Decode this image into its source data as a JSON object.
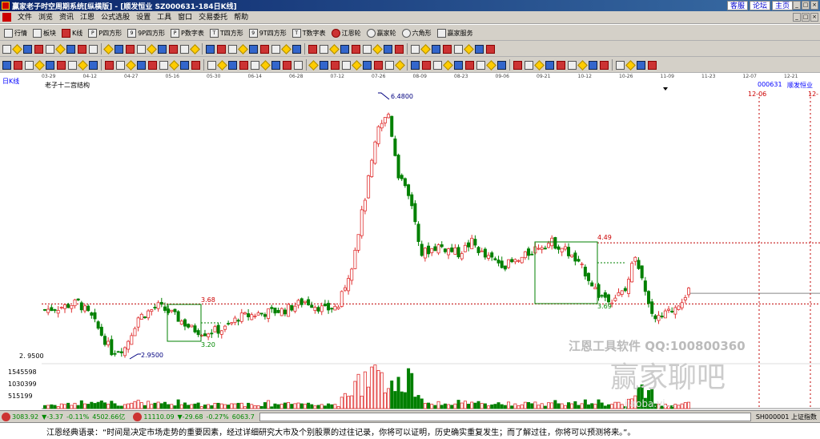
{
  "window": {
    "title": "赢家老子时空周期系统[纵横版] - [顺发恒业   SZ000631-184日K线]",
    "links": [
      "客服",
      "论坛",
      "主页"
    ],
    "win_controls": [
      "_",
      "□",
      "×"
    ]
  },
  "menu": {
    "items": [
      "文件",
      "浏览",
      "资讯",
      "江恩",
      "公式选股",
      "设置",
      "工具",
      "窗口",
      "交易委托",
      "帮助"
    ]
  },
  "toolbar1": {
    "items": [
      "行情",
      "板块",
      "K线",
      "P四方形",
      "9P四方形",
      "P数字表",
      "T四方形",
      "9T四方形",
      "T数字表",
      "江恩轮",
      "赢家轮",
      "六角形",
      "赢家服务"
    ]
  },
  "chart": {
    "period_label": "日K线",
    "indicator_name": "老子十二宫结构",
    "stock_code": "000631",
    "stock_name": "顺发恒业",
    "top_dates": [
      "03-29",
      "04-12",
      "04-27",
      "05-16",
      "05-30",
      "06-14",
      "06-28",
      "07-12",
      "07-26",
      "08-09",
      "08-23",
      "09-06",
      "09-21",
      "10-12",
      "10-26",
      "11-09",
      "11-23",
      "12-07",
      "12-21"
    ],
    "marker_dates": [
      "12-06",
      "12-"
    ],
    "price_labels": {
      "high": "6.4800",
      "low": "2.9500",
      "low_axis": "2. 9500",
      "box1_top": "3.68",
      "box1_bottom": "3.20",
      "box2_top": "4.49",
      "box2_bottom": "3.69"
    },
    "volume_axis": [
      "1545598",
      "1030399",
      "515199"
    ],
    "watermark": {
      "line1": "江恩工具软件  QQ:100800360",
      "brand": "赢家聊吧",
      "url": "jiaoba.yi..."
    },
    "colors": {
      "up": "#e03030",
      "down": "#008000",
      "box": "#008000",
      "hline": "#c00000",
      "annot": "#000080"
    },
    "chart_data": {
      "type": "candlestick",
      "title": "老子十二宫结构",
      "x": [
        "03-29",
        "04-12",
        "04-27",
        "05-16",
        "05-30",
        "06-14",
        "06-28",
        "07-12",
        "07-26",
        "08-09",
        "08-23",
        "09-06",
        "09-21",
        "10-12",
        "10-26",
        "11-09",
        "11-23"
      ],
      "close": [
        3.65,
        3.55,
        3.05,
        3.5,
        3.35,
        3.45,
        3.6,
        3.75,
        6.1,
        4.3,
        4.35,
        4.2,
        4.3,
        3.75,
        4.0,
        3.5,
        3.9
      ],
      "high_label": 6.48,
      "low_label": 2.95,
      "volume_ticks": [
        515199,
        1030399,
        1545598
      ]
    }
  },
  "status": {
    "sh_index": "3083.92",
    "sh_change": "▼-3.37",
    "sh_pct": "-0.11%",
    "sh_amount": "4502.66亿",
    "sz_index": "11110.09",
    "sz_change": "▼-29.68",
    "sz_pct": "-0.27%",
    "sz_amount": "6063.7",
    "right_label": "SH000001 上证指数"
  },
  "quote": {
    "text": "江恩经典语录：“时间是决定市场走势的重要因素，经过详细研究大市及个别股票的过往记录，你将可以证明，历史确实重复发生；而了解过往，你将可以预测将来。”。"
  }
}
